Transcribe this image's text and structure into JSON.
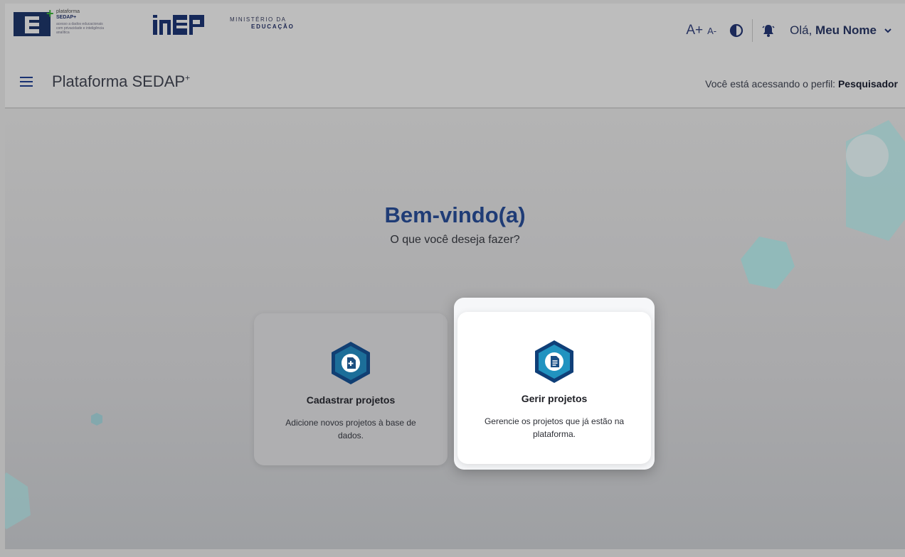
{
  "header": {
    "sedap_logo": {
      "line1": "plataforma",
      "line2": "SEDAP+",
      "line3": "acesso a dados educacionais com privacidade e inteligência analítica"
    },
    "inep_logo": "inep",
    "ministry_logo": {
      "line1": "MINISTÉRIO DA",
      "line2": "EDUCAÇÃO"
    },
    "font_increase": "A+",
    "font_decrease": "A-",
    "greeting_prefix": "Olá,",
    "user_name": "Meu Nome",
    "icons": [
      "contrast-icon",
      "bell-icon",
      "chevron-down-icon"
    ]
  },
  "appbar": {
    "title": "Plataforma SEDAP",
    "title_suffix": "+",
    "profile_prefix": "Você está acessando o perfil:",
    "profile_name": "Pesquisador"
  },
  "main": {
    "heading": "Bem-vindo(a)",
    "subheading": "O que você deseja fazer?",
    "cards": [
      {
        "title": "Cadastrar projetos",
        "description": "Adicione novos projetos à base de dados.",
        "icon": "add-document-icon",
        "highlighted": false
      },
      {
        "title": "Gerir projetos",
        "description": "Gerencie os projetos que já estão na plataforma.",
        "icon": "document-icon",
        "highlighted": true
      }
    ]
  },
  "colors": {
    "primary": "#1f3c76",
    "navy": "#16295a",
    "icon_teal": "#1c7fa0",
    "overlay_bg": "#a9a9ab"
  }
}
